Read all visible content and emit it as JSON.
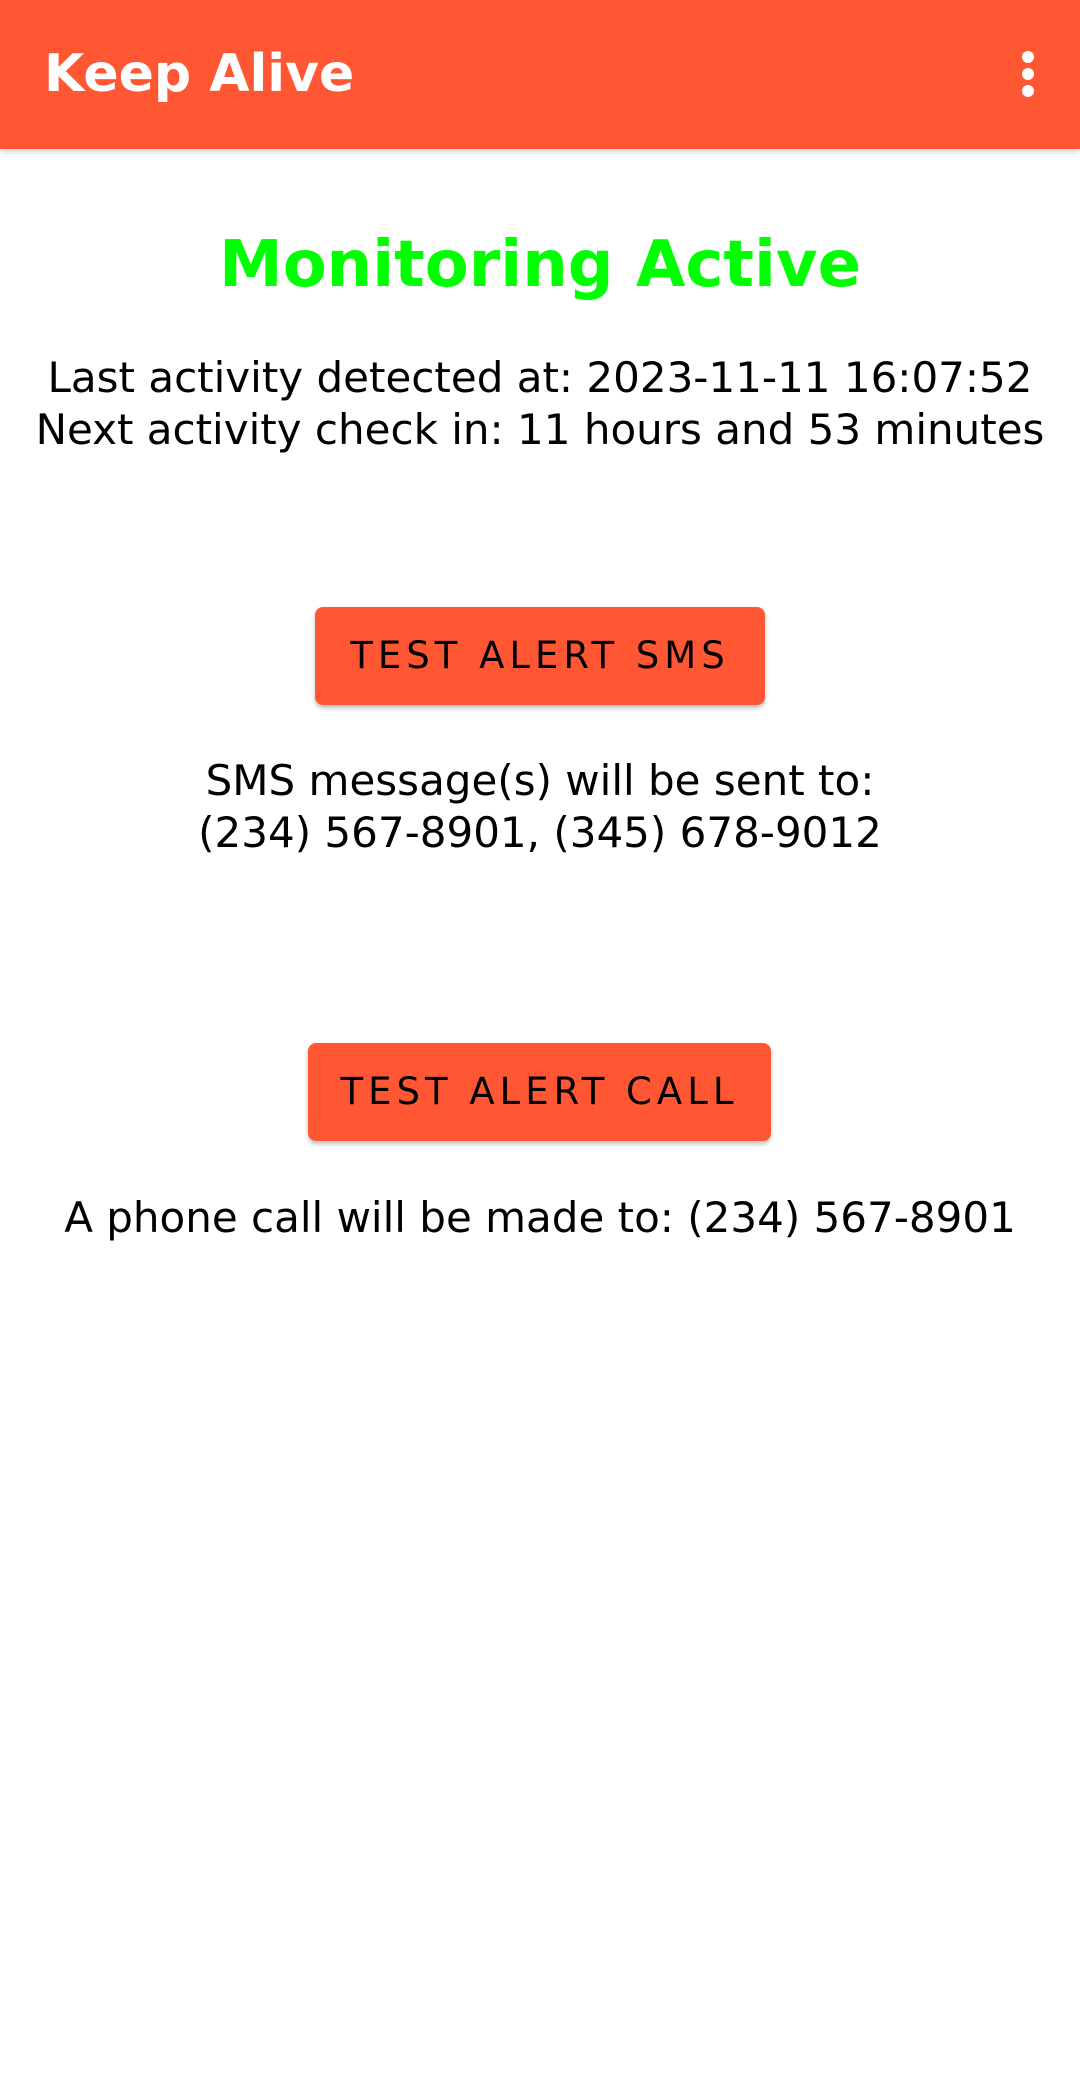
{
  "app_bar": {
    "title": "Keep Alive",
    "menu_icon": "more-vert-icon",
    "color": "#FF5733"
  },
  "status": {
    "title": "Monitoring Active",
    "color": "#00FF00",
    "last_activity": "Last activity detected at: 2023-11-11 16:07:52",
    "next_check": "Next activity check in: 11 hours and 53 minutes"
  },
  "sms": {
    "button_label": "TEST ALERT SMS",
    "info_line1": "SMS message(s) will be sent to:",
    "info_line2": "(234) 567-8901, (345) 678-9012"
  },
  "call": {
    "button_label": "TEST ALERT CALL",
    "info": "A phone call will be made to: (234) 567-8901"
  }
}
